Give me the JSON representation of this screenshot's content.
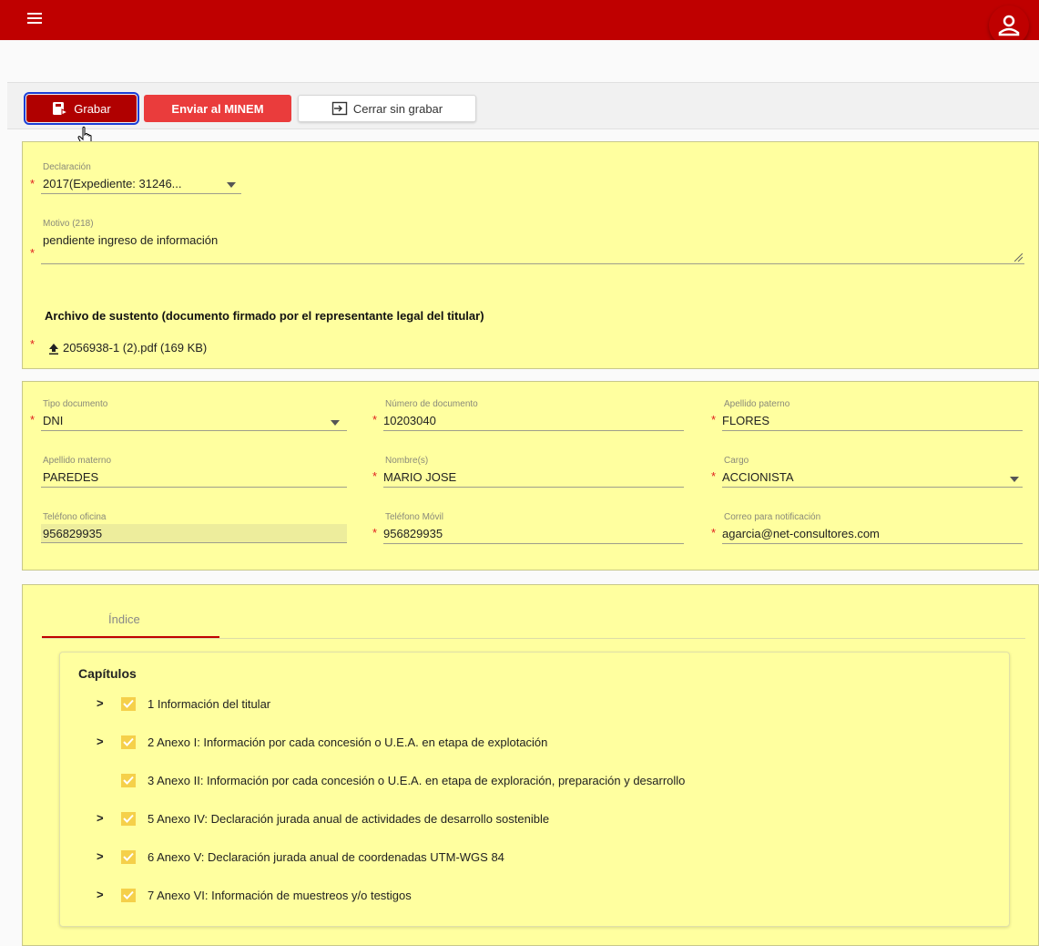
{
  "toolbar": {
    "grabar_label": "Grabar",
    "enviar_label": "Enviar al MINEM",
    "cerrar_label": "Cerrar sin grabar"
  },
  "declaracion": {
    "label": "Declaración",
    "value": "2017(Expediente: 31246..."
  },
  "motivo": {
    "label": "Motivo (218)",
    "value": "pendiente ingreso de información"
  },
  "archivo": {
    "title": "Archivo de sustento (documento firmado por el representante legal del titular)",
    "filename": "2056938-1 (2).pdf (169 KB)"
  },
  "representante": {
    "tipo_documento": {
      "label": "Tipo documento",
      "value": "DNI"
    },
    "numero_documento": {
      "label": "Número de documento",
      "value": "10203040"
    },
    "apellido_paterno": {
      "label": "Apellido paterno",
      "value": "FLORES"
    },
    "apellido_materno": {
      "label": "Apellido materno",
      "value": "PAREDES"
    },
    "nombres": {
      "label": "Nombre(s)",
      "value": "MARIO JOSE"
    },
    "cargo": {
      "label": "Cargo",
      "value": "ACCIONISTA"
    },
    "telefono_oficina": {
      "label": "Teléfono oficina",
      "value": "956829935"
    },
    "telefono_movil": {
      "label": "Teléfono Móvil",
      "value": "956829935"
    },
    "correo": {
      "label": "Correo para notificación",
      "value": "agarcia@net-consultores.com"
    }
  },
  "indice": {
    "tab_label": "Índice",
    "capitulos_title": "Capítulos",
    "chapters": [
      {
        "label": "1 Información del titular",
        "expandable": true
      },
      {
        "label": "2 Anexo I: Información por cada concesión o U.E.A. en etapa de explotación",
        "expandable": true
      },
      {
        "label": "3 Anexo II: Información por cada concesión o U.E.A. en etapa de exploración, preparación y desarrollo",
        "expandable": false
      },
      {
        "label": "5 Anexo IV: Declaración jurada anual de actividades de desarrollo sostenible",
        "expandable": true
      },
      {
        "label": "6 Anexo V: Declaración jurada anual de coordenadas UTM-WGS 84",
        "expandable": true
      },
      {
        "label": "7 Anexo VI: Información de muestreos y/o testigos",
        "expandable": true
      }
    ]
  },
  "colors": {
    "header": "#bf0000",
    "panel": "#ffff9f",
    "grabar": "#b00000",
    "enviar": "#ea3c3c",
    "checkbox": "#f5d04a",
    "required": "#e0201e"
  }
}
